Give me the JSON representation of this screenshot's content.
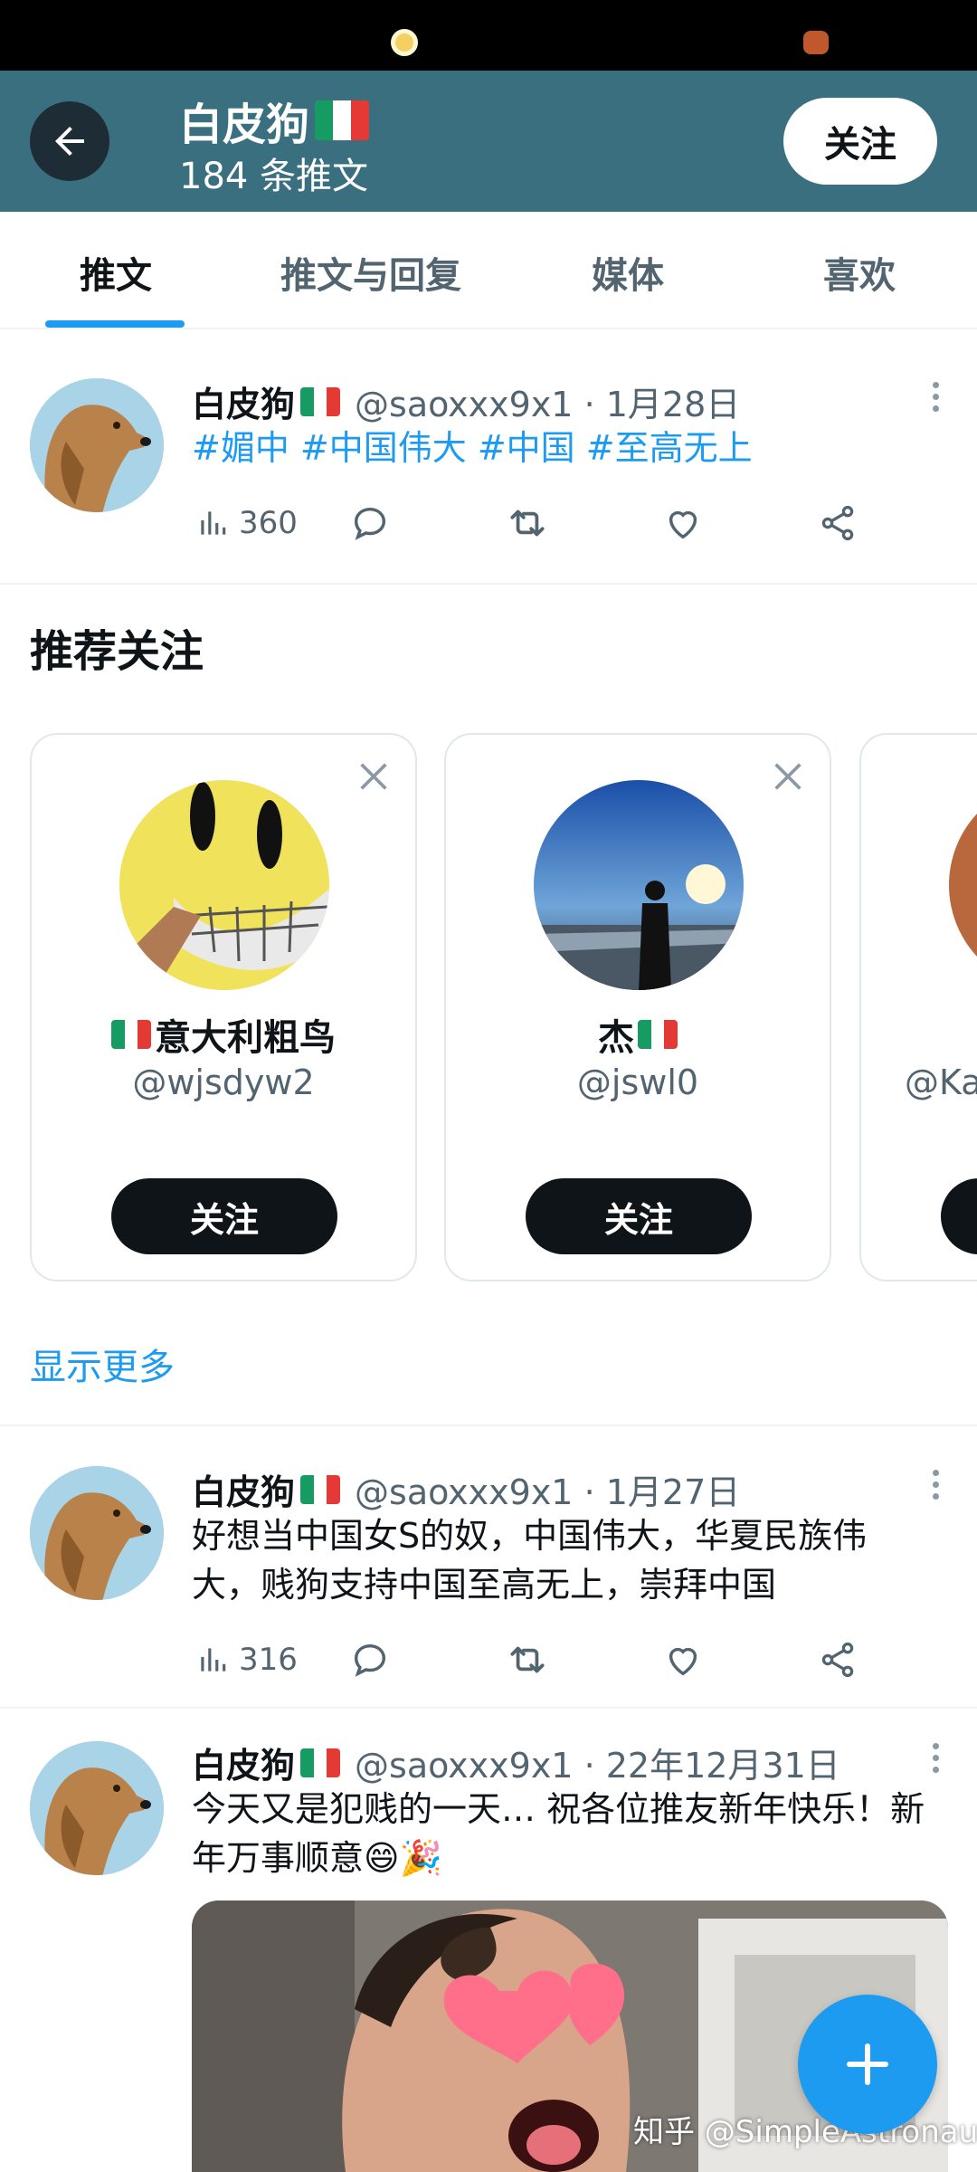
{
  "header": {
    "name": "白皮狗",
    "tweet_count": "184 条推文",
    "follow_label": "关注"
  },
  "tabs": [
    {
      "label": "推文",
      "active": true
    },
    {
      "label": "推文与回复",
      "active": false
    },
    {
      "label": "媒体",
      "active": false
    },
    {
      "label": "喜欢",
      "active": false
    }
  ],
  "tweets": [
    {
      "name": "白皮狗",
      "meta": "@saoxxx9x1 · 1月28日",
      "text": "#媚中 #中国伟大 #中国 #至高无上",
      "views": "360"
    },
    {
      "name": "白皮狗",
      "meta": "@saoxxx9x1 · 1月27日",
      "text": "好想当中国女S的奴，中国伟大，华夏民族伟大，贱狗支持中国至高无上，崇拜中国",
      "views": "316"
    },
    {
      "name": "白皮狗",
      "meta": "@saoxxx9x1 · 22年12月31日",
      "text": "今天又是犯贱的一天… 祝各位推友新年快乐！新年万事顺意😄🎉"
    }
  ],
  "recommend": {
    "title": "推荐关注",
    "cards": [
      {
        "name": "意大利粗鸟",
        "handle": "@wjsdyw2",
        "follow_label": "关注"
      },
      {
        "name": "杰",
        "handle": "@jswl0",
        "follow_label": "关注"
      },
      {
        "handle": "@Ka"
      }
    ],
    "show_more": "显示更多"
  },
  "watermark": "知乎 @SimpleAstronaut",
  "colors": {
    "header_bg": "#3a6f80",
    "accent": "#1d9bf0",
    "text_primary": "#0f1419",
    "text_secondary": "#536471"
  },
  "icons": [
    "back-arrow-icon",
    "more-vertical-icon",
    "views-icon",
    "reply-icon",
    "retweet-icon",
    "like-icon",
    "share-icon",
    "close-icon",
    "compose-plus-icon"
  ]
}
